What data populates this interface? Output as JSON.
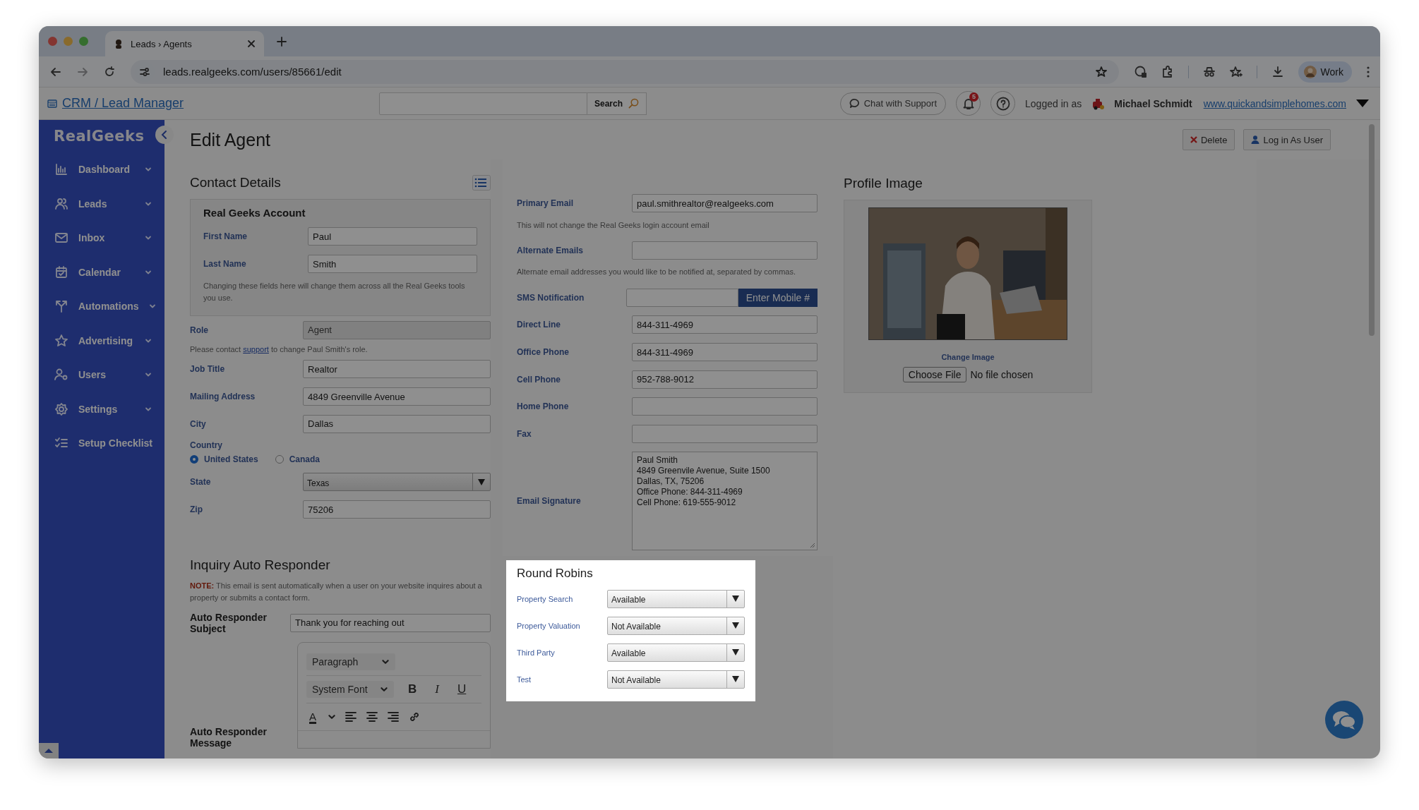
{
  "browser": {
    "tab_title": "Leads › Agents",
    "url": "leads.realgeeks.com/users/85661/edit",
    "profile": "Work"
  },
  "app_header": {
    "title": "CRM / Lead Manager",
    "search_button": "Search",
    "chat_button": "Chat with Support",
    "notification_count": "5",
    "logged_in_label": "Logged in as",
    "user_name": "Michael Schmidt",
    "site_link": "www.quickandsimplehomes.com"
  },
  "sidebar": {
    "logo": "RealGeeks",
    "items": [
      {
        "label": "Dashboard",
        "has_submenu": true
      },
      {
        "label": "Leads",
        "has_submenu": true
      },
      {
        "label": "Inbox",
        "has_submenu": true
      },
      {
        "label": "Calendar",
        "has_submenu": true
      },
      {
        "label": "Automations",
        "has_submenu": true
      },
      {
        "label": "Advertising",
        "has_submenu": true
      },
      {
        "label": "Users",
        "has_submenu": true
      },
      {
        "label": "Settings",
        "has_submenu": true
      },
      {
        "label": "Setup Checklist",
        "has_submenu": false
      }
    ]
  },
  "page": {
    "title": "Edit Agent",
    "buttons": [
      {
        "label": "Delete",
        "kind": "delete"
      },
      {
        "label": "Log in As User",
        "kind": "login"
      }
    ]
  },
  "contact_details": {
    "heading": "Contact Details",
    "account": {
      "title": "Real Geeks Account",
      "fields": [
        {
          "label": "First Name",
          "value": "Paul"
        },
        {
          "label": "Last Name",
          "value": "Smith"
        }
      ],
      "note": "Changing these fields here will change them across all the Real Geeks tools you use."
    },
    "role": {
      "label": "Role",
      "value": "Agent",
      "disabled": true
    },
    "role_note": {
      "before": "Please contact ",
      "link": "support",
      "after": " to change Paul Smith's role."
    },
    "fields": [
      {
        "label": "Job Title",
        "value": "Realtor"
      },
      {
        "label": "Mailing Address",
        "value": "4849 Greenville Avenue"
      },
      {
        "label": "City",
        "value": "Dallas"
      }
    ],
    "country": {
      "label": "Country",
      "options": [
        {
          "label": "United States",
          "selected": true
        },
        {
          "label": "Canada",
          "selected": false
        }
      ]
    },
    "state": {
      "label": "State",
      "value": "Texas"
    },
    "zip": {
      "label": "Zip",
      "value": "75206"
    }
  },
  "auto_responder": {
    "heading": "Inquiry Auto Responder",
    "note_label": "NOTE:",
    "note": " This email is sent automatically when a user on your website inquires about a property or submits a contact form.",
    "subject_label": "Auto Responder Subject",
    "subject": "Thank you for reaching out",
    "message_label": "Auto Responder Message",
    "editor": {
      "block_format": "Paragraph",
      "font": "System Font",
      "bold": "B",
      "italic": "I",
      "underline": "U",
      "text_color": "A"
    }
  },
  "contact_info": [
    {
      "kind": "field",
      "label": "Primary Email",
      "value": "paul.smithrealtor@realgeeks.com"
    },
    {
      "kind": "hint",
      "text": "This will not change the Real Geeks login account email"
    },
    {
      "kind": "field",
      "label": "Alternate Emails"
    },
    {
      "kind": "hint",
      "text": "Alternate email addresses you would like to be notified at, separated by commas."
    },
    {
      "kind": "sms",
      "label": "SMS Notification",
      "button": "Enter Mobile #"
    },
    {
      "kind": "field",
      "label": "Direct Line",
      "value": "844-311-4969"
    },
    {
      "kind": "field",
      "label": "Office Phone",
      "value": "844-311-4969"
    },
    {
      "kind": "field",
      "label": "Cell Phone",
      "value": "952-788-9012"
    },
    {
      "kind": "field",
      "label": "Home Phone"
    },
    {
      "kind": "field",
      "label": "Fax"
    },
    {
      "kind": "textarea",
      "label": "Email Signature",
      "lines": [
        "Paul Smith",
        "4849 Greenvile Avenue, Suite 1500",
        "Dallas, TX, 75206",
        "Office Phone: 844-311-4969",
        "Cell Phone: 619-555-9012"
      ]
    }
  ],
  "round_robins": {
    "title": "Round Robins",
    "rows": [
      {
        "label": "Property Search",
        "value": "Available"
      },
      {
        "label": "Property Valuation",
        "value": "Not Available"
      },
      {
        "label": "Third Party",
        "value": "Available"
      },
      {
        "label": "Test",
        "value": "Not Available"
      }
    ]
  },
  "profile_image": {
    "heading": "Profile Image",
    "change_label": "Change Image",
    "choose_button": "Choose File",
    "file_status": "No file chosen"
  }
}
